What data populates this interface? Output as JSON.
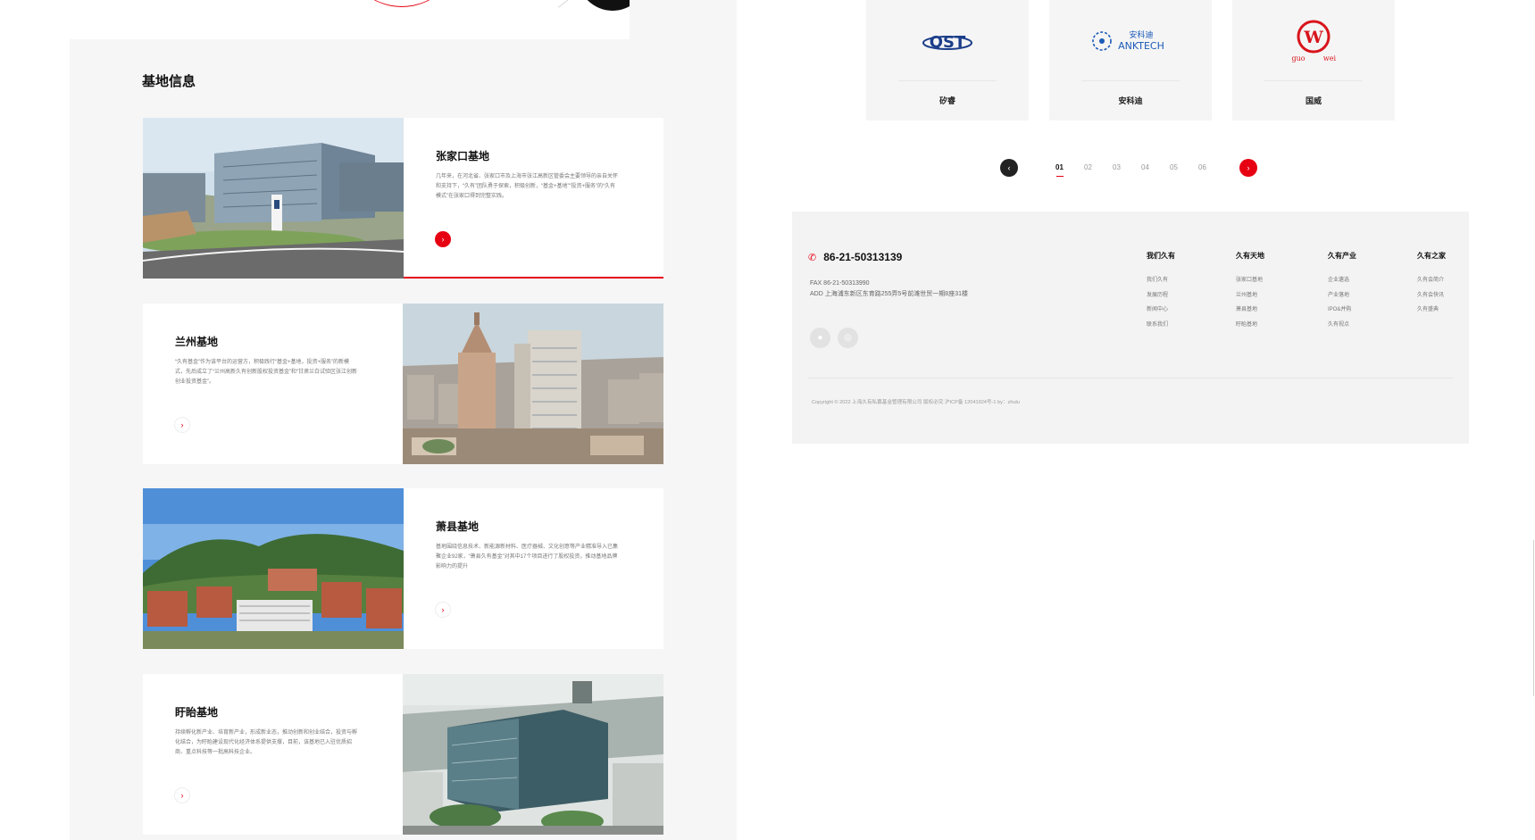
{
  "section": {
    "title": "基地信息"
  },
  "bases": [
    {
      "name": "张家口基地",
      "desc": "几年来，在河北省、张家口市及上海市张江高新区管委会主要领导的亲自关怀和支持下，“久有”团队勇于探索，积极创新，“基金+基地”“投资+服务”的“久有模式”在张家口得到完整实践。",
      "action": "›"
    },
    {
      "name": "兰州基地",
      "desc": "“久有基金”作为该平台的运营方，积极践行“基金+基地，投资+服务”的新模式，先后成立了“兰州高新久有创新股权投资基金”和“甘肃兰白试验区张江创新创业投资基金”。",
      "action": "›"
    },
    {
      "name": "萧县基地",
      "desc": "基地围绕信息技术、新能源新材料、医疗器械、文化创意等产业精准导入已集聚企业92家，“萧县久有基金”对其中17个项目进行了股权投资，推动基地品牌影响力的提升",
      "action": "›"
    },
    {
      "name": "盱眙基地",
      "desc": "持续孵化新产业、培育新产业，形成新业态，推动创新和创业结合，投资与孵化结合，为盱眙建设现代化经济体系提供支撑，目前，该基地已入驻优质招商、重点科技等一批高科技企业。",
      "action": "›"
    }
  ],
  "partners": [
    {
      "name": "矽睿",
      "logo_text": "QST"
    },
    {
      "name": "安科迪",
      "logo_cn": "安科迪",
      "logo_en": "ANKTECH"
    },
    {
      "name": "国威",
      "logo_left": "guo",
      "logo_right": "wei",
      "logo_mark": "W"
    }
  ],
  "pager": {
    "prev": "‹",
    "next": "›",
    "pages": [
      "01",
      "02",
      "03",
      "04",
      "05",
      "06"
    ],
    "active": "01"
  },
  "footer": {
    "phone": "86-21-50313139",
    "fax": "FAX   86-21-50313990",
    "address": "ADD  上海浦东新区东育路255弄5号前滩世贸一期8座31楼",
    "columns": [
      {
        "title": "我们久有",
        "links": [
          "我们久有",
          "发展历程",
          "新闻中心",
          "联系我们"
        ]
      },
      {
        "title": "久有天地",
        "links": [
          "张家口基地",
          "兰州基地",
          "萧县基地",
          "盱眙基地"
        ]
      },
      {
        "title": "久有产业",
        "links": [
          "企业遴选",
          "产业落地",
          "IPO&并购",
          "久有视点"
        ]
      },
      {
        "title": "久有之家",
        "links": [
          "久有会简介",
          "久有会快讯",
          "久有盛典"
        ]
      }
    ],
    "copyright": "Copyright © 2022 上海久有私募基金管理有限公司 版权必究 沪ICP备 12041924号-1 by：zhulu"
  }
}
